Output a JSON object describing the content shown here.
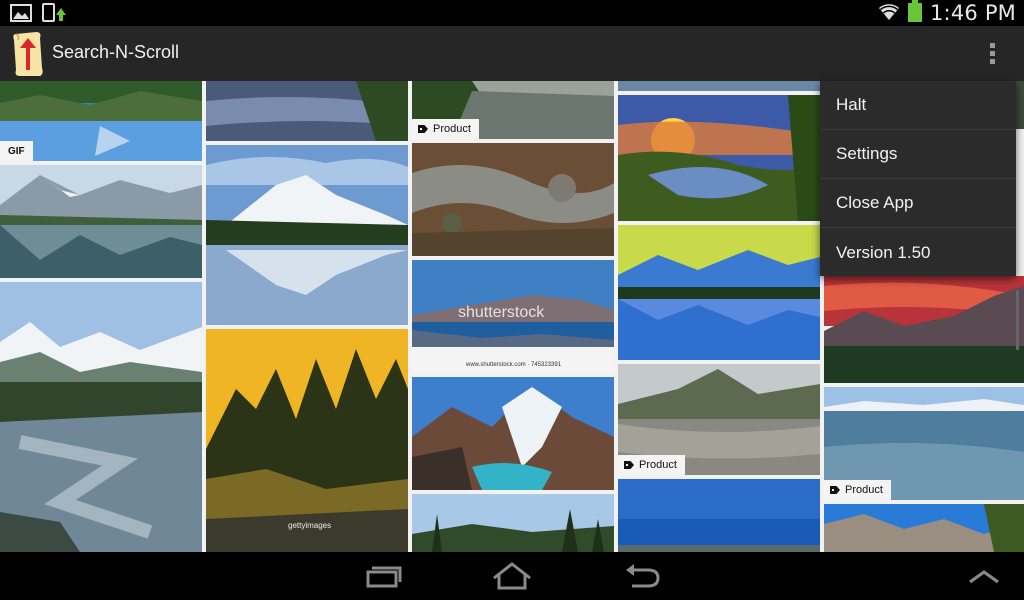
{
  "status_bar": {
    "time": "1:46 PM",
    "left_icons": [
      "gallery-notification-icon",
      "download-notification-icon"
    ],
    "right_icons": [
      "wifi-icon",
      "battery-icon"
    ]
  },
  "action_bar": {
    "title": "Search-N-Scroll",
    "logo_icon": "scroll-arrow-logo-icon",
    "overflow_icon": "more-vertical-icon"
  },
  "menu": {
    "items": [
      {
        "label": "Halt"
      },
      {
        "label": "Settings"
      },
      {
        "label": "Close App"
      },
      {
        "label": "Version 1.50"
      }
    ]
  },
  "badges": {
    "gif": "GIF",
    "product": "Product"
  },
  "watermarks": {
    "shutterstock": "shutterstock",
    "shutterstock_id": "www.shutterstock.com · 745323391",
    "gettyimages": "gettyimages"
  },
  "nav_bar": {
    "icons": [
      "recent-apps-icon",
      "home-icon",
      "back-icon",
      "hide-keyboard-icon"
    ]
  },
  "colors": {
    "action_bar": "#262626",
    "menu_bg": "#2b2b2b",
    "battery": "#6ac43a",
    "grid_gap": "#f2f2f2"
  }
}
